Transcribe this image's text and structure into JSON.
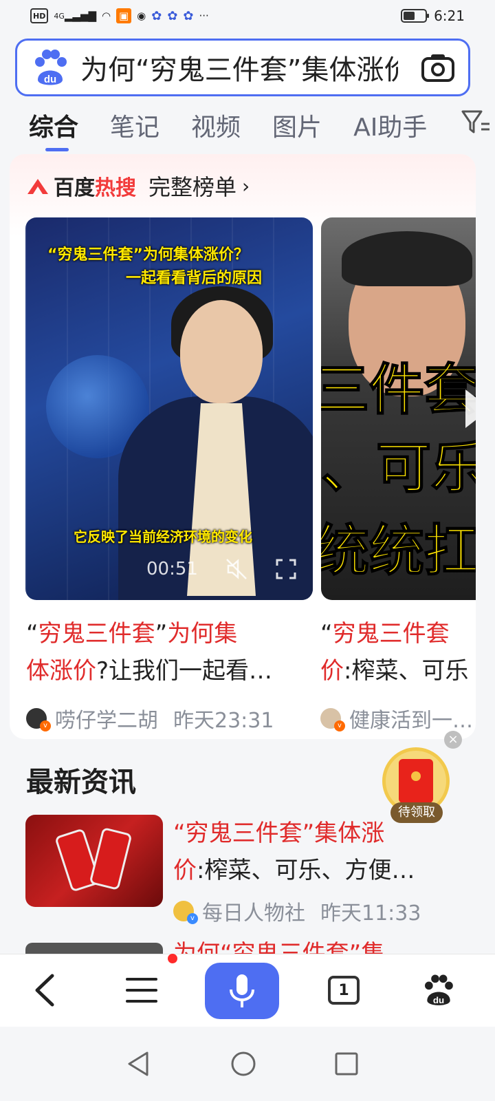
{
  "status_bar": {
    "network_label": "HD",
    "signal_label": "4G",
    "time": "6:21",
    "more": "···"
  },
  "search": {
    "query": "为何“穷鬼三件套”集体涨价"
  },
  "tabs": [
    {
      "label": "综合",
      "active": true
    },
    {
      "label": "笔记",
      "active": false
    },
    {
      "label": "视频",
      "active": false
    },
    {
      "label": "图片",
      "active": false
    },
    {
      "label": "AI助手",
      "active": false
    }
  ],
  "hot_search": {
    "brand_prefix": "百度",
    "brand_suffix": "热搜",
    "full_list_label": "完整榜单",
    "chevron": "›",
    "videos": [
      {
        "caption_top_1": "“穷鬼三件套”为何集体涨价？",
        "caption_top_2": "一起看看背后的原因",
        "caption_bottom": "它反映了当前经济环境的变化",
        "duration": "00:51",
        "title_line1_prefix": "“",
        "title_line1_hl": "穷鬼三件套",
        "title_line1_mid": "”",
        "title_line1_hl2": "为何集",
        "title_line2_hl": "体涨价",
        "title_line2_rest": "?让我们一起看…",
        "author": "唠仔学二胡",
        "time": "昨天23:31"
      },
      {
        "overlay_1": "三件套”",
        "overlay_2": "、可乐",
        "overlay_3": "统统扛不",
        "title_line1_prefix": "“",
        "title_line1_hl": "穷鬼三件套",
        "title_line2_hl": "价",
        "title_line2_rest": ":榨菜、可乐",
        "author": "健康活到一…",
        "time": ""
      }
    ]
  },
  "red_packet": {
    "label": "待领取",
    "close": "×"
  },
  "news": {
    "section_title": "最新资讯",
    "items": [
      {
        "line1_prefix": "“",
        "line1_hl": "穷鬼三件套”集体涨",
        "line2_hl": "价",
        "line2_rest": ":榨菜、可乐、方便…",
        "source": "每日人物社",
        "time": "昨天11:33"
      }
    ],
    "peek_title": "为何“穷鬼三件套”集"
  },
  "toolbar": {
    "tab_count": "1"
  },
  "colors": {
    "accent": "#4e6ef2",
    "highlight": "#e02b2b",
    "meta": "#8a8f99"
  }
}
